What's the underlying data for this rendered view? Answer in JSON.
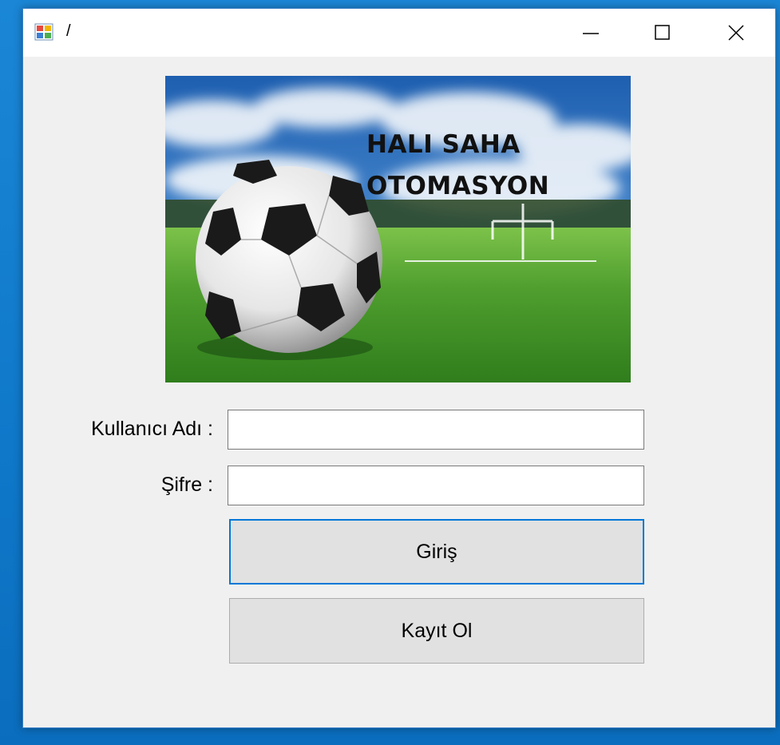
{
  "window": {
    "title": "/",
    "controls": {
      "minimize": "minimize",
      "maximize": "maximize",
      "close": "close"
    }
  },
  "banner": {
    "title_line1": "HALI SAHA",
    "title_line2": "OTOMASYON"
  },
  "form": {
    "username_label": "Kullanıcı Adı :",
    "username_value": "",
    "password_label": "Şifre :",
    "password_value": "",
    "login_button": "Giriş",
    "register_button": "Kayıt Ol"
  },
  "colors": {
    "focus_border": "#0078d7",
    "window_bg": "#f0f0f0",
    "desktop_bg": "#0f78c9"
  }
}
